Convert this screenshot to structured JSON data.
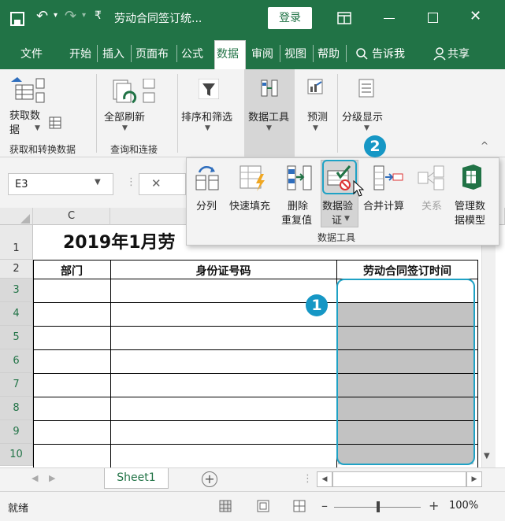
{
  "title_bar": {
    "doc_title": "劳动合同签订统...",
    "login_label": "登录"
  },
  "menu": {
    "items": [
      "文件",
      "开始",
      "插入",
      "页面布",
      "公式",
      "数据",
      "审阅",
      "视图",
      "帮助"
    ],
    "active": "数据",
    "tell_me": "告诉我",
    "share": "共享"
  },
  "ribbon": {
    "get_data_l1": "获取数",
    "get_data_l2": "据",
    "refresh_all": "全部刷新",
    "sort_filter": "排序和筛选",
    "data_tools": "数据工具",
    "forecast": "预测",
    "outline": "分级显示",
    "group_get_transform": "获取和转换数据",
    "group_queries": "查询和连接"
  },
  "namebox": {
    "value": "E3"
  },
  "data_tools_panel": {
    "split": "分列",
    "flash_fill": "快速填充",
    "remove_dup_l1": "删除",
    "remove_dup_l2": "重复值",
    "validation_l1": "数据验",
    "validation_l2": "证",
    "consolidate": "合并计算",
    "relationships": "关系",
    "manage_model_l1": "管理数",
    "manage_model_l2": "据模型",
    "group_label": "数据工具"
  },
  "sheet": {
    "col_c": "C",
    "title": "2019年1月劳",
    "headers": [
      "部门",
      "身份证号码",
      "劳动合同签订时间"
    ],
    "rows": [
      "1",
      "2",
      "3",
      "4",
      "5",
      "6",
      "7",
      "8",
      "9",
      "10"
    ]
  },
  "badges": {
    "one": "1",
    "two": "2"
  },
  "tabs": {
    "sheet1": "Sheet1"
  },
  "status": {
    "ready": "就绪",
    "zoom": "100%"
  }
}
